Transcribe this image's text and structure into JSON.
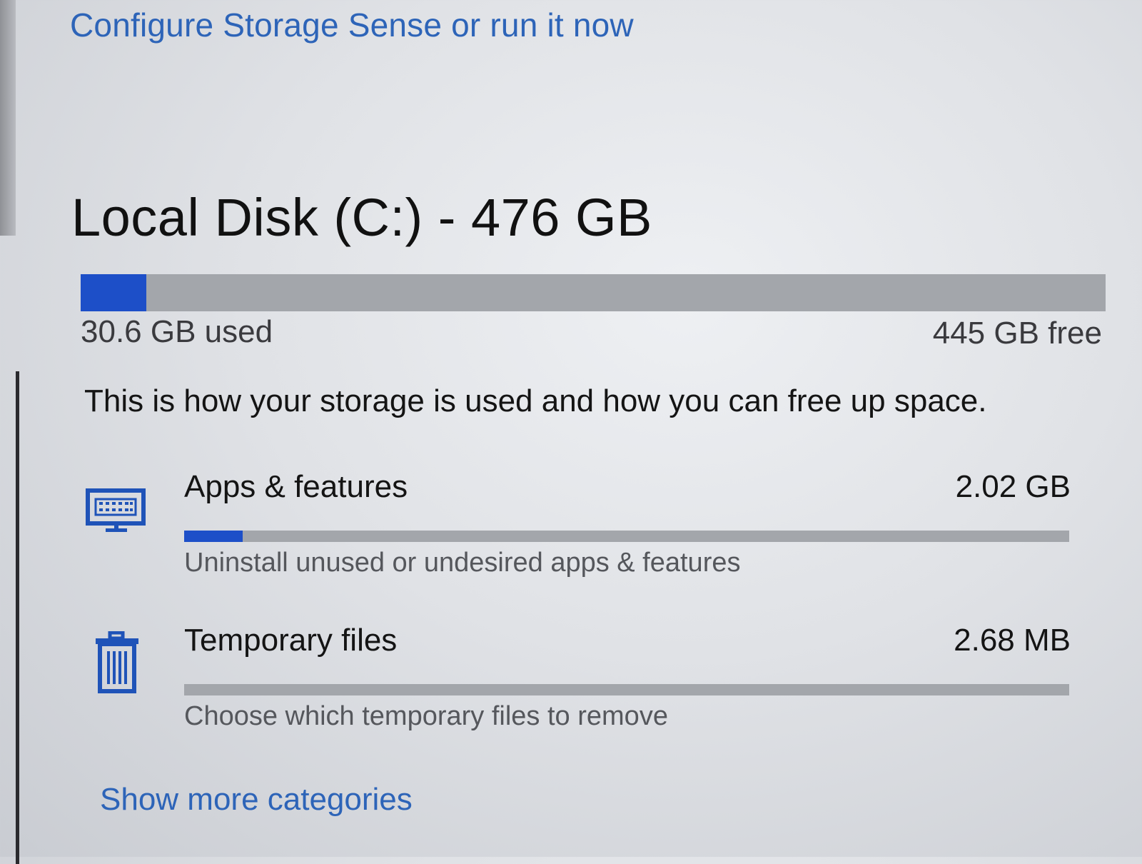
{
  "storage_sense": {
    "configure_label": "Configure Storage Sense or run it now"
  },
  "drive": {
    "title": "Local Disk (C:) - 476 GB",
    "used_label": "30.6 GB used",
    "free_label": "445 GB free",
    "used_fraction": 0.064
  },
  "description": "This is how your storage is used and how you can free up space.",
  "categories": [
    {
      "name": "Apps & features",
      "size": "2.02 GB",
      "description": "Uninstall unused or undesired apps & features",
      "icon": "desktop-keyboard-icon",
      "fraction": 0.066
    },
    {
      "name": "Temporary files",
      "size": "2.68 MB",
      "description": "Choose which temporary files to remove",
      "icon": "trash-icon",
      "fraction": 0.0
    }
  ],
  "show_more_label": "Show more categories",
  "colors": {
    "accent": "#1d4fc8",
    "link": "#2d64b8",
    "track": "#a3a6ab"
  }
}
